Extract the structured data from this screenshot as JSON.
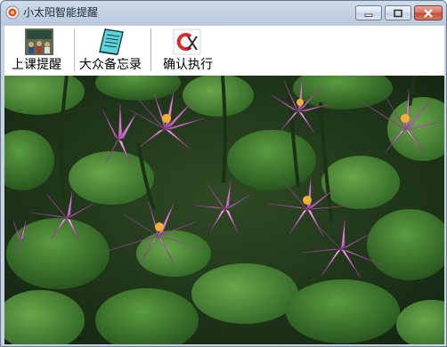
{
  "window": {
    "title": "小太阳智能提醒",
    "buttons": {
      "minimize": "minimize-icon",
      "maximize": "maximize-icon",
      "close": "close-icon"
    }
  },
  "toolbar": {
    "items": [
      {
        "label": "上课提醒",
        "icon": "classroom-icon"
      },
      {
        "label": "大众备忘录",
        "icon": "notebook-icon"
      },
      {
        "label": "确认执行",
        "icon": "confirm-execute-icon"
      }
    ]
  },
  "content": {
    "image": "water-lily-pond-photo"
  },
  "colors": {
    "title_text": "#1b2a3a",
    "close_button": "#c24b35",
    "lily_petal": "#d98ad4",
    "leaf": "#3f7a2f"
  }
}
